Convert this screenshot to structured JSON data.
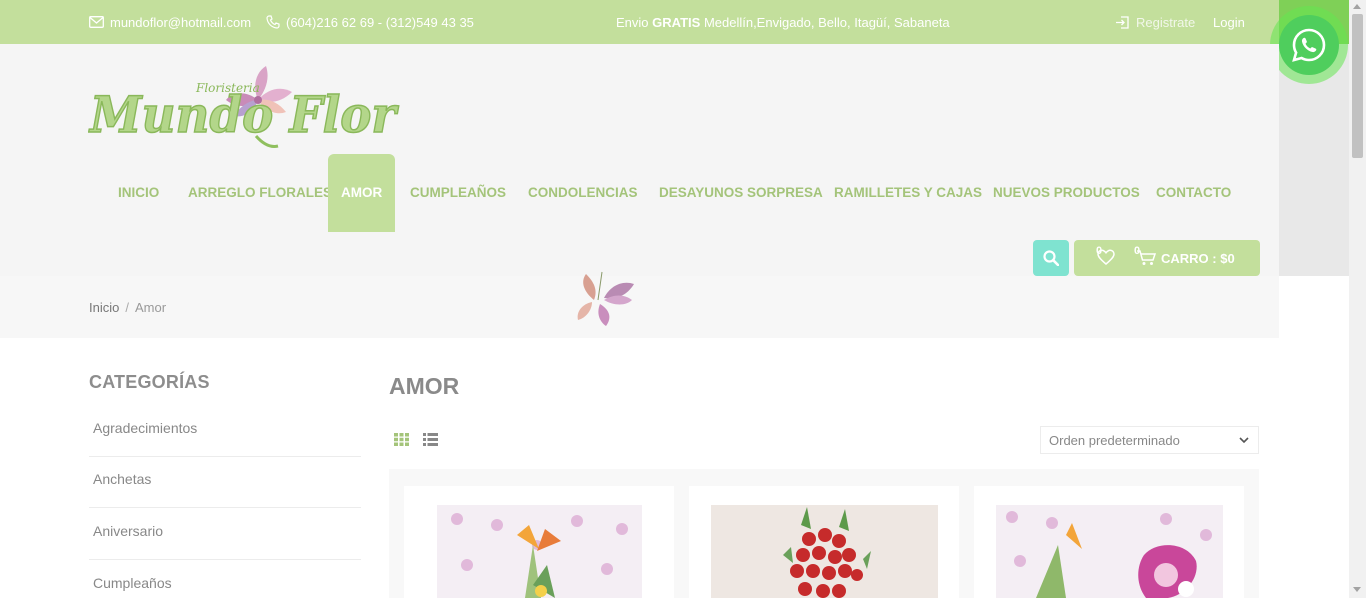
{
  "topbar": {
    "email": "mundoflor@hotmail.com",
    "phones": "(604)216 62 69 - (312)549 43 35",
    "shipping_prefix": "Envio",
    "shipping_bold": "GRATIS",
    "shipping_rest": "Medellín,Envigado, Bello, Itagüí, Sabaneta",
    "register_label": "Registrate",
    "login_label": "Login"
  },
  "logo": {
    "small_text": "Floristeria",
    "brand_text": "Mundo Flor"
  },
  "nav": {
    "items": [
      {
        "label": "INICIO"
      },
      {
        "label": "ARREGLO FLORALES"
      },
      {
        "label": "AMOR"
      },
      {
        "label": "CUMPLEAÑOS"
      },
      {
        "label": "CONDOLENCIAS"
      },
      {
        "label": "DESAYUNOS SORPRESA"
      },
      {
        "label": "RAMILLETES Y CAJAS"
      },
      {
        "label": "NUEVOS PRODUCTOS"
      },
      {
        "label": "CONTACTO"
      }
    ],
    "active_index": 2
  },
  "cart": {
    "wishlist_count": "0",
    "cart_count": "0",
    "label": "CARRO : $0"
  },
  "breadcrumb": {
    "home": "Inicio",
    "separator": "/",
    "current": "Amor"
  },
  "sidebar": {
    "title": "CATEGORÍAS",
    "items": [
      {
        "label": "Agradecimientos"
      },
      {
        "label": "Anchetas"
      },
      {
        "label": "Aniversario"
      },
      {
        "label": "Cumpleaños"
      }
    ]
  },
  "main": {
    "title": "AMOR",
    "sort_selected": "Orden predeterminado"
  },
  "colors": {
    "brand_green": "#c3df9c",
    "nav_text": "#a4c47a",
    "search_teal": "#7fe3d0",
    "whatsapp_green": "#4fce5d"
  },
  "icons": {
    "email": "envelope-icon",
    "phone": "phone-icon",
    "register": "login-arrow-icon",
    "whatsapp": "whatsapp-icon",
    "search": "search-icon",
    "wishlist": "heart-icon",
    "cart": "cart-icon",
    "grid": "grid-view-icon",
    "list": "list-view-icon"
  }
}
